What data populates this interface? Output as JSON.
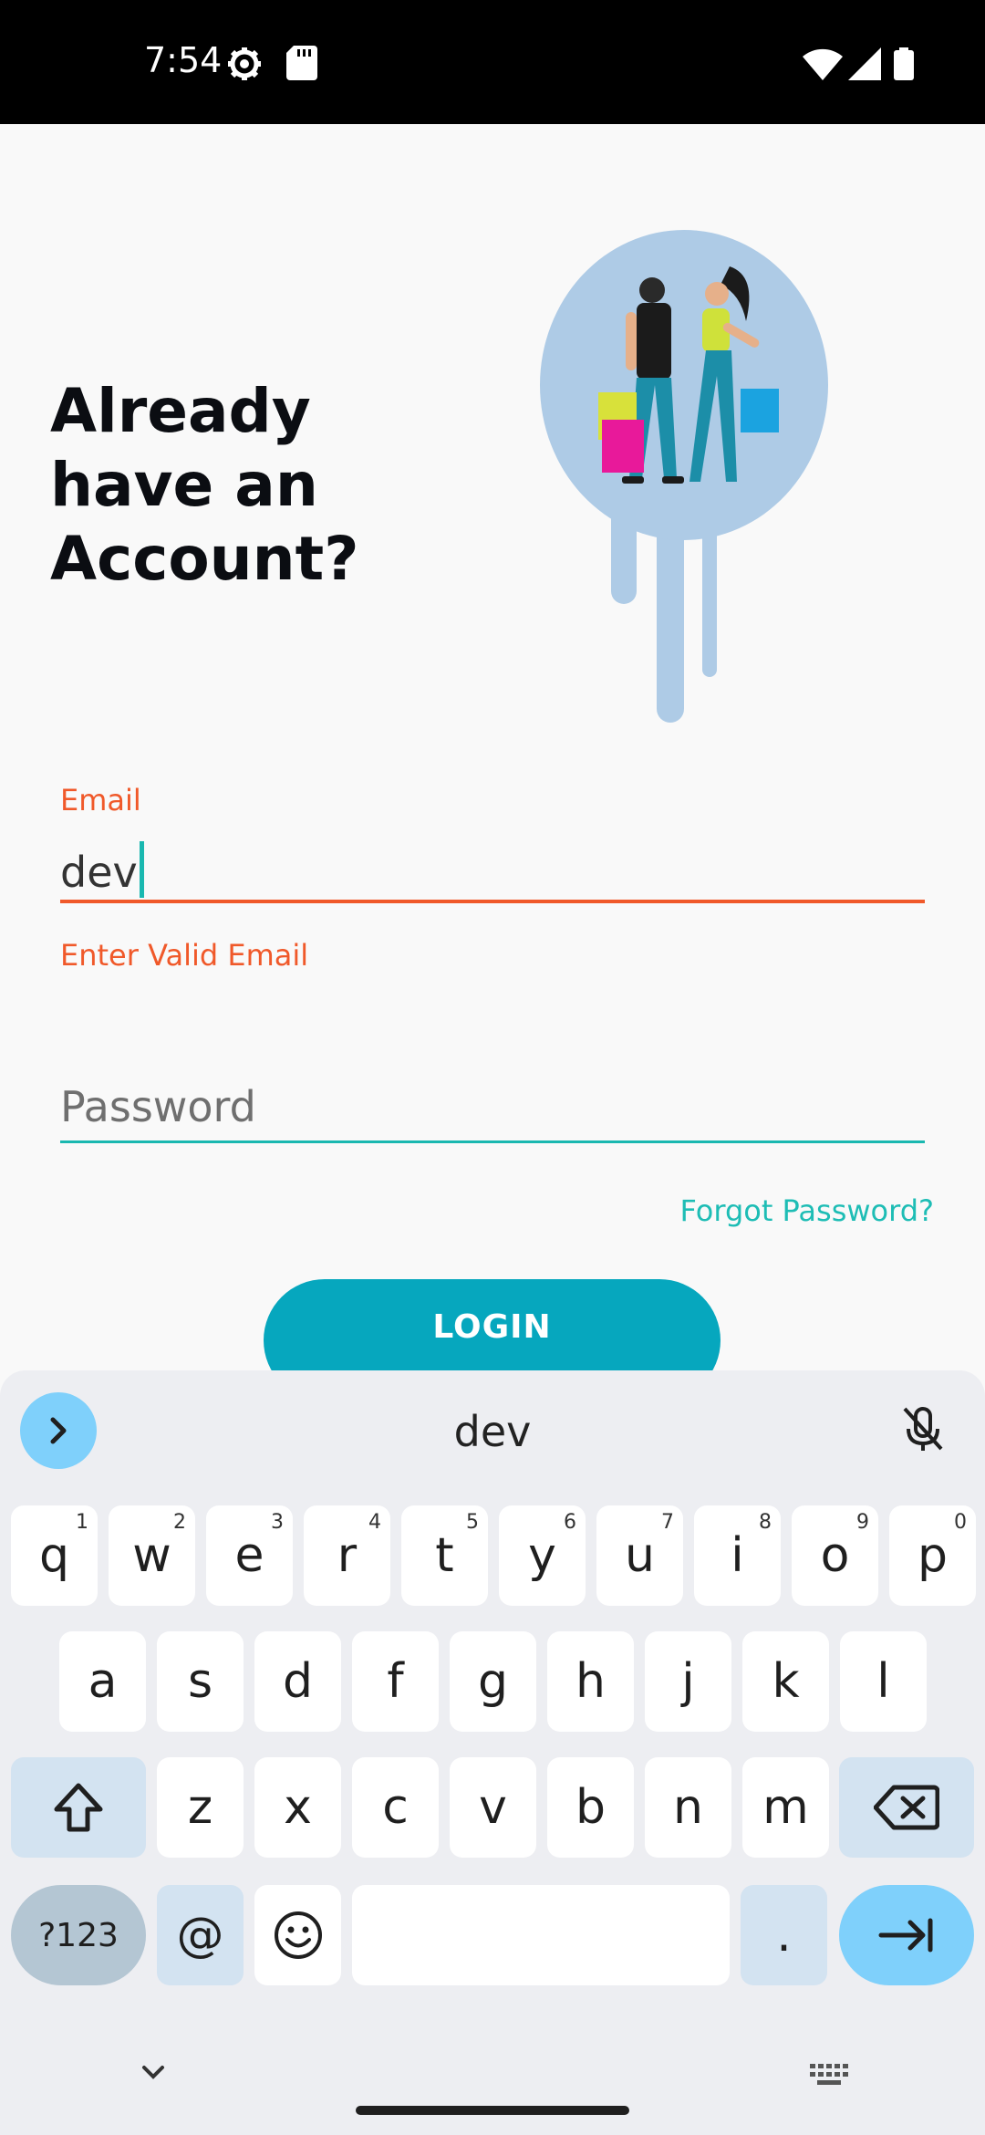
{
  "status_bar": {
    "time": "7:54",
    "icons": [
      "settings-icon",
      "sd-card-icon",
      "wifi-icon",
      "signal-icon",
      "battery-icon"
    ]
  },
  "login": {
    "headline": [
      "Already",
      "have an",
      "Account?"
    ],
    "email_label": "Email",
    "email_value": "dev",
    "email_error": "Enter Valid Email",
    "password_placeholder": "Password",
    "forgot_password": "Forgot Password?",
    "login_button": "LOGIN"
  },
  "colors": {
    "accent_teal": "#1ab8b0",
    "error_orange": "#f0592a",
    "button": "#06a7be"
  },
  "keyboard": {
    "suggestion": "dev",
    "row1": [
      {
        "k": "q",
        "h": "1"
      },
      {
        "k": "w",
        "h": "2"
      },
      {
        "k": "e",
        "h": "3"
      },
      {
        "k": "r",
        "h": "4"
      },
      {
        "k": "t",
        "h": "5"
      },
      {
        "k": "y",
        "h": "6"
      },
      {
        "k": "u",
        "h": "7"
      },
      {
        "k": "i",
        "h": "8"
      },
      {
        "k": "o",
        "h": "9"
      },
      {
        "k": "p",
        "h": "0"
      }
    ],
    "row2": [
      "a",
      "s",
      "d",
      "f",
      "g",
      "h",
      "j",
      "k",
      "l"
    ],
    "row3": [
      "z",
      "x",
      "c",
      "v",
      "b",
      "n",
      "m"
    ],
    "symbols_key": "?123",
    "at_key": "@",
    "period_key": "."
  }
}
